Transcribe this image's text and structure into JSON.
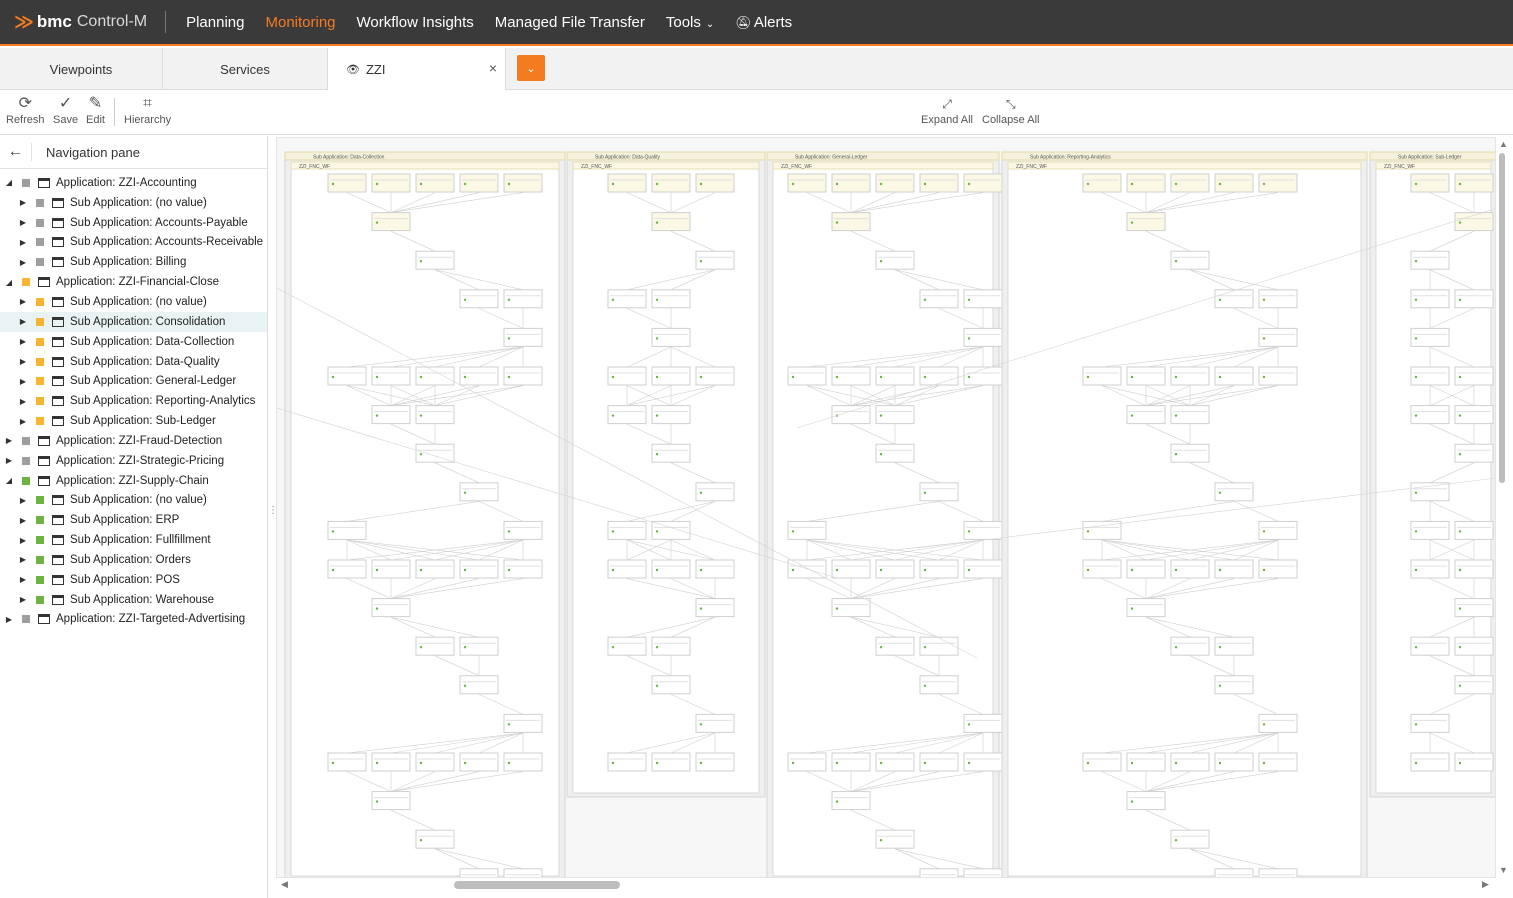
{
  "brand": {
    "logo": "≫",
    "company": "bmc",
    "product": "Control-M"
  },
  "topnav": [
    {
      "label": "Planning",
      "active": false
    },
    {
      "label": "Monitoring",
      "active": true
    },
    {
      "label": "Workflow Insights",
      "active": false
    },
    {
      "label": "Managed File Transfer",
      "active": false
    },
    {
      "label": "Tools",
      "active": false
    },
    {
      "label": "Alerts",
      "active": false
    }
  ],
  "tabs": {
    "viewpoints": "Viewpoints",
    "services": "Services",
    "active": "ZZI",
    "close": "×"
  },
  "toolbar": {
    "refresh": "Refresh",
    "save": "Save",
    "edit": "Edit",
    "hierarchy": "Hierarchy",
    "expand_all": "Expand All",
    "collapse_all": "Collapse All"
  },
  "nav_pane": {
    "title": "Navigation pane",
    "items": [
      {
        "label": "Application: ZZI-Accounting",
        "level": 0,
        "expanded": true,
        "status_color": "#9e9e9e"
      },
      {
        "label": "Sub Application: (no value)",
        "level": 1,
        "expanded": false,
        "status_color": "#9e9e9e"
      },
      {
        "label": "Sub Application: Accounts-Payable",
        "level": 1,
        "expanded": false,
        "status_color": "#9e9e9e"
      },
      {
        "label": "Sub Application: Accounts-Receivable",
        "level": 1,
        "expanded": false,
        "status_color": "#9e9e9e"
      },
      {
        "label": "Sub Application: Billing",
        "level": 1,
        "expanded": false,
        "status_color": "#9e9e9e"
      },
      {
        "label": "Application: ZZI-Financial-Close",
        "level": 0,
        "expanded": true,
        "status_color": "#f5b52e"
      },
      {
        "label": "Sub Application: (no value)",
        "level": 1,
        "expanded": false,
        "status_color": "#f5b52e"
      },
      {
        "label": "Sub Application: Consolidation",
        "level": 1,
        "expanded": false,
        "status_color": "#f5b52e",
        "selected": true
      },
      {
        "label": "Sub Application: Data-Collection",
        "level": 1,
        "expanded": false,
        "status_color": "#f5b52e"
      },
      {
        "label": "Sub Application: Data-Quality",
        "level": 1,
        "expanded": false,
        "status_color": "#f5b52e"
      },
      {
        "label": "Sub Application: General-Ledger",
        "level": 1,
        "expanded": false,
        "status_color": "#f5b52e"
      },
      {
        "label": "Sub Application: Reporting-Analytics",
        "level": 1,
        "expanded": false,
        "status_color": "#f5b52e"
      },
      {
        "label": "Sub Application: Sub-Ledger",
        "level": 1,
        "expanded": false,
        "status_color": "#f5b52e"
      },
      {
        "label": "Application: ZZI-Fraud-Detection",
        "level": 0,
        "expanded": false,
        "status_color": "#9e9e9e"
      },
      {
        "label": "Application: ZZI-Strategic-Pricing",
        "level": 0,
        "expanded": false,
        "status_color": "#9e9e9e"
      },
      {
        "label": "Application: ZZI-Supply-Chain",
        "level": 0,
        "expanded": true,
        "status_color": "#6cb33f"
      },
      {
        "label": "Sub Application: (no value)",
        "level": 1,
        "expanded": false,
        "status_color": "#6cb33f"
      },
      {
        "label": "Sub Application: ERP",
        "level": 1,
        "expanded": false,
        "status_color": "#6cb33f"
      },
      {
        "label": "Sub Application: Fullfillment",
        "level": 1,
        "expanded": false,
        "status_color": "#6cb33f"
      },
      {
        "label": "Sub Application: Orders",
        "level": 1,
        "expanded": false,
        "status_color": "#6cb33f"
      },
      {
        "label": "Sub Application: POS",
        "level": 1,
        "expanded": false,
        "status_color": "#6cb33f"
      },
      {
        "label": "Sub Application: Warehouse",
        "level": 1,
        "expanded": false,
        "status_color": "#6cb33f"
      },
      {
        "label": "Application: ZZI-Targeted-Advertising",
        "level": 0,
        "expanded": false,
        "status_color": "#9e9e9e"
      }
    ]
  },
  "canvas": {
    "groups": [
      {
        "title": "Sub Application: Data-Collection",
        "folder": "ZZI_FNC_WF"
      },
      {
        "title": "Sub Application: Data-Quality",
        "folder": "ZZI_FNC_WF"
      },
      {
        "title": "Sub Application: General-Ledger",
        "folder": "ZZI_FNC_WF"
      },
      {
        "title": "Sub Application: Reporting-Analytics",
        "folder": "ZZI_FNC_WF"
      },
      {
        "title": "Sub Application: Sub-Ledger",
        "folder": "ZZI_FNC_WF"
      }
    ]
  },
  "colors": {
    "accent": "#f47b20",
    "topbar": "#3a3a3a",
    "selected_row": "#e9f3f4",
    "status_ok": "#6cb33f",
    "status_warn": "#f5b52e",
    "status_neutral": "#9e9e9e"
  },
  "icons": [
    "bmc-logo-icon",
    "tools-chevron-icon",
    "alerts-bell-icon",
    "eye-icon",
    "close-icon",
    "dropdown-chevron-icon",
    "refresh-icon",
    "save-check-icon",
    "edit-pencil-icon",
    "hierarchy-icon",
    "expand-all-icon",
    "collapse-all-icon",
    "back-arrow-icon",
    "window-icon",
    "caret-icon",
    "status-square-icon"
  ]
}
